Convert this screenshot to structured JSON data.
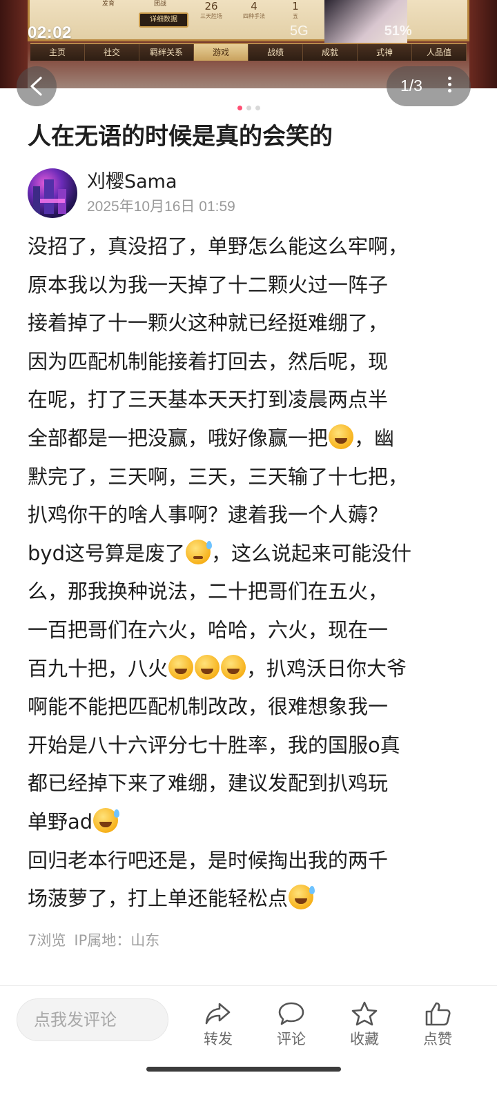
{
  "status_bar": {
    "time": "02:02",
    "network": "5G",
    "battery": "51%"
  },
  "hero": {
    "stats": [
      {
        "value": "26",
        "label": "三天胜场"
      },
      {
        "value": "4",
        "label": "四种手法"
      },
      {
        "value": "1",
        "label": "五"
      }
    ],
    "labels": [
      "发育",
      "团战"
    ],
    "detail_button": "详细数据",
    "tabs": [
      "主页",
      "社交",
      "羁绊关系",
      "游戏",
      "战绩",
      "成就",
      "式神",
      "人品值"
    ],
    "active_tab": "游戏"
  },
  "carousel": {
    "counter": "1/3",
    "total": 3,
    "current": 1
  },
  "post": {
    "title": "人在无语的时候是真的会笑的",
    "author": "刈樱Sama",
    "date": "2025年10月16日 01:59",
    "lines": [
      {
        "text": "没招了，真没招了，单野怎么能这么牢啊，",
        "emoji_after": ""
      },
      {
        "text": "原本我以为我一天掉了十二颗火过一阵子",
        "emoji_after": ""
      },
      {
        "text": "接着掉了十一颗火这种就已经挺难绷了，",
        "emoji_after": ""
      },
      {
        "text": "因为匹配机制能接着打回去，然后呢，现",
        "emoji_after": ""
      },
      {
        "text": "在呢，打了三天基本天天打到凌晨两点半",
        "emoji_after": ""
      },
      {
        "text": "全部都是一把没赢，哦好像赢一把",
        "emoji_after": "rofl",
        "tail": "，幽"
      },
      {
        "text": "默完了，三天啊，三天，三天输了十七把，",
        "emoji_after": ""
      },
      {
        "text": "扒鸡你干的啥人事啊？逮着我一个人薅？",
        "emoji_after": ""
      },
      {
        "text": "byd这号算是废了",
        "emoji_after": "sad",
        "tail": "，这么说起来可能没什"
      },
      {
        "text": "么，那我换种说法，二十把哥们在五火，",
        "emoji_after": ""
      },
      {
        "text": "一百把哥们在六火，哈哈，六火，现在一",
        "emoji_after": ""
      },
      {
        "text": "百九十把，八火",
        "emoji_after": "rofl3",
        "tail": "，扒鸡沃日你大爷"
      },
      {
        "text": "啊能不能把匹配机制改改，很难想象我一",
        "emoji_after": ""
      },
      {
        "text": "开始是八十六评分七十胜率，我的国服o真",
        "emoji_after": ""
      },
      {
        "text": "都已经掉下来了难绷，建议发配到扒鸡玩",
        "emoji_after": ""
      },
      {
        "text": "单野ad",
        "emoji_after": "sweat",
        "tail": ""
      },
      {
        "text": "回归老本行吧还是，是时候掏出我的两千",
        "emoji_after": ""
      },
      {
        "text": "场菠萝了，打上单还能轻松点",
        "emoji_after": "sweat",
        "tail": ""
      }
    ],
    "views": "7浏览",
    "ip_location": "IP属地：山东"
  },
  "bottom_bar": {
    "comment_placeholder": "点我发评论",
    "actions": [
      {
        "label": "转发",
        "icon": "share-icon"
      },
      {
        "label": "评论",
        "icon": "comment-icon"
      },
      {
        "label": "收藏",
        "icon": "star-icon"
      },
      {
        "label": "点赞",
        "icon": "thumbs-up-icon"
      }
    ]
  }
}
